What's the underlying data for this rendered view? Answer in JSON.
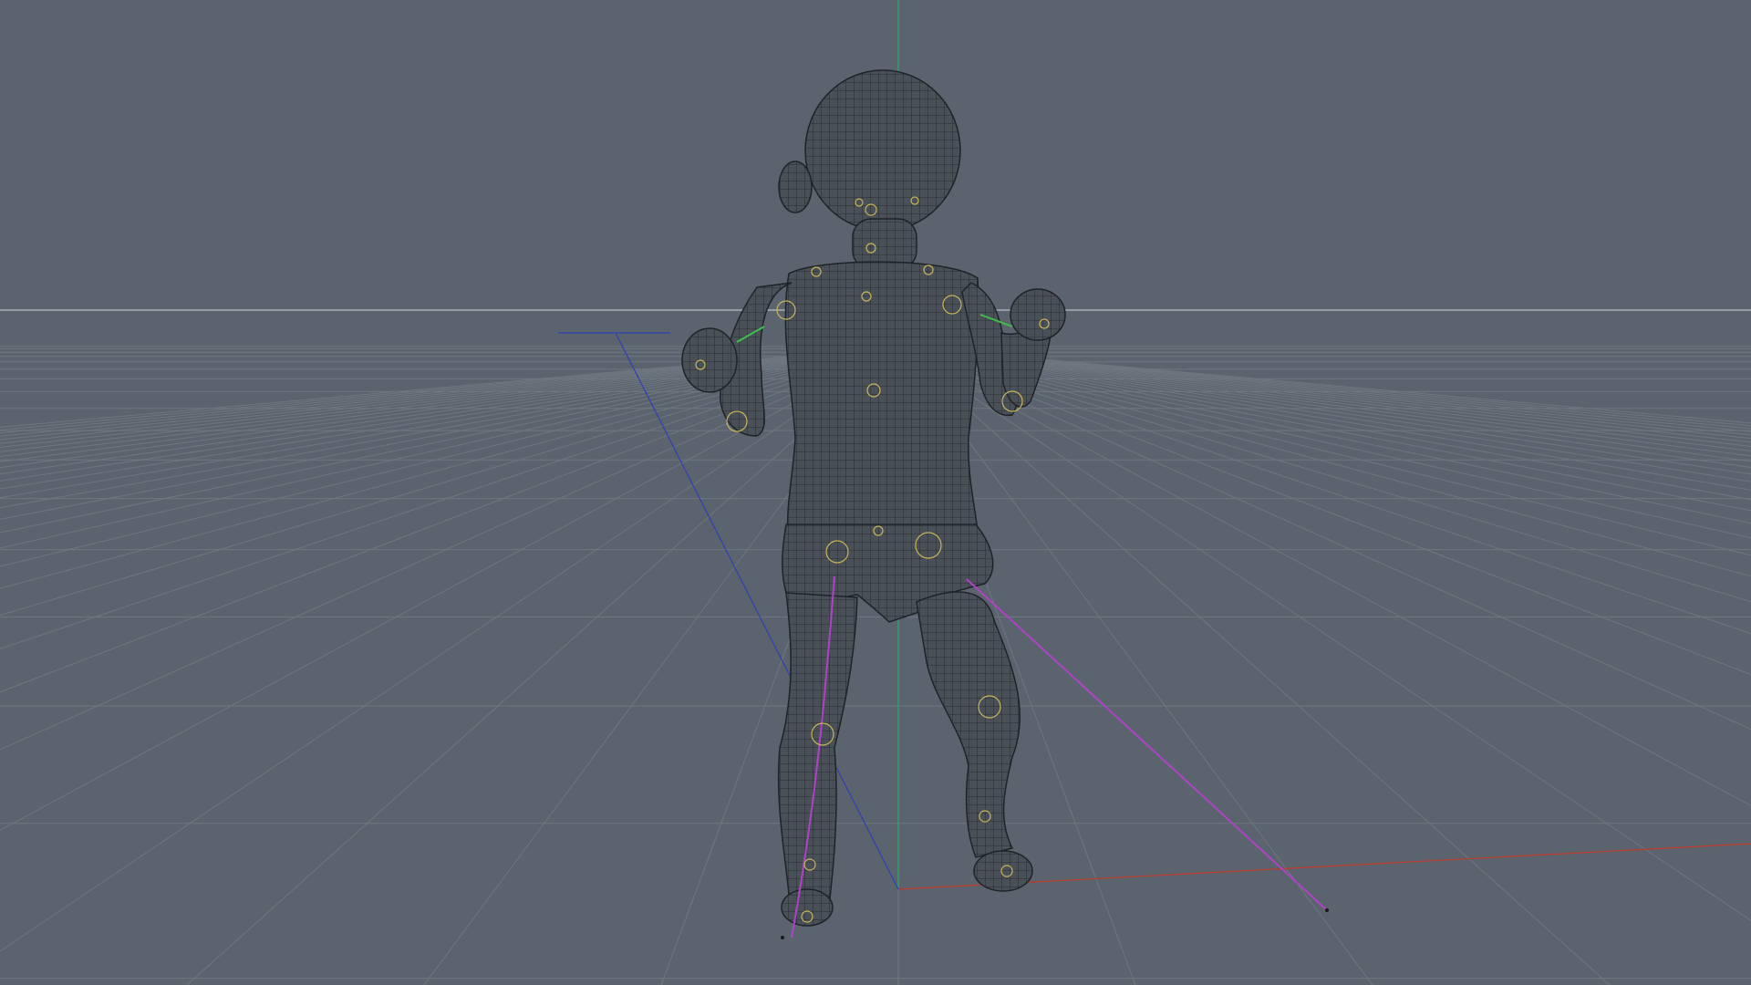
{
  "viewport": {
    "background_color": "#5b646e",
    "grid_color": "#6e7780",
    "horizon_line_color": "#b9bec4",
    "mesh_fill_color": "#4a5058",
    "mesh_line_color": "#1f2328",
    "axis_colors": {
      "x": "#c0392b",
      "y": "#27ae60",
      "z": "#2f3fb5"
    },
    "ik_handle_color": "#b042c8",
    "joint_marker_color": "#c8b45a",
    "arm_handle_color": "#3fbf4a"
  },
  "scene_objects": [
    {
      "name": "baby-character-mesh",
      "type": "polygon-mesh"
    },
    {
      "name": "character-rig",
      "type": "joint-rig"
    },
    {
      "name": "ground-grid",
      "type": "grid"
    }
  ]
}
